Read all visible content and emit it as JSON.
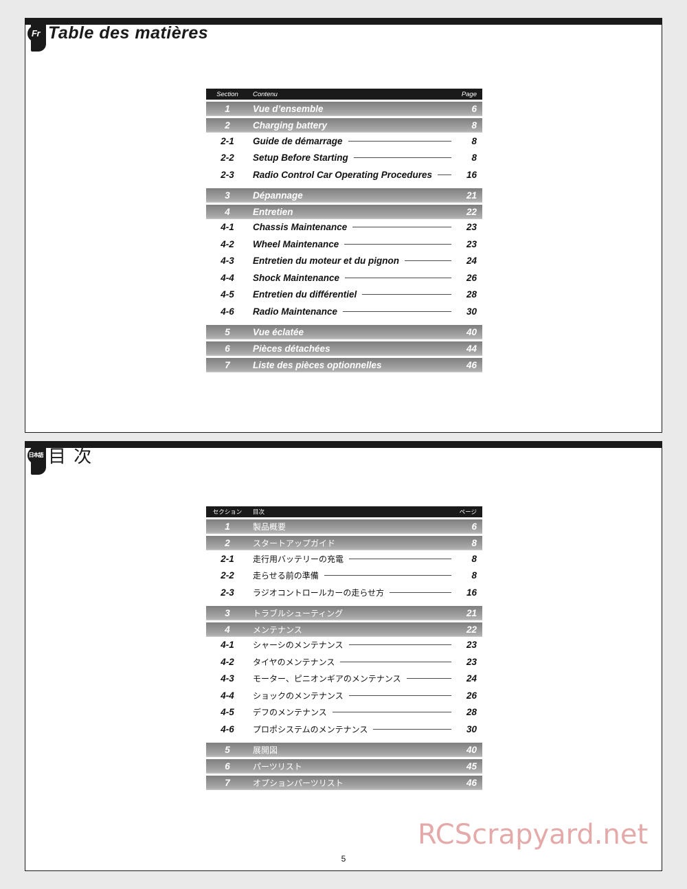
{
  "document": {
    "page_number": "5",
    "watermark": "RCScrapyard.net"
  },
  "sections": {
    "french": {
      "badge": "Fr",
      "title": "Table des matières",
      "table": {
        "headers": {
          "section": "Section",
          "content": "Contenu",
          "page": "Page"
        },
        "rows": [
          {
            "type": "major",
            "section": "1",
            "name": "Vue d’ensemble",
            "page": "6"
          },
          {
            "type": "major",
            "section": "2",
            "name": "Charging battery",
            "page": "8"
          },
          {
            "type": "sub",
            "section": "2-1",
            "name": "Guide de démarrage",
            "page": "8"
          },
          {
            "type": "sub",
            "section": "2-2",
            "name": "Setup Before Starting",
            "page": "8"
          },
          {
            "type": "sub",
            "section": "2-3",
            "name": "Radio Control Car Operating Procedures",
            "page": "16"
          },
          {
            "type": "major",
            "section": "3",
            "name": "Dépannage",
            "page": "21"
          },
          {
            "type": "major",
            "section": "4",
            "name": "Entretien",
            "page": "22"
          },
          {
            "type": "sub",
            "section": "4-1",
            "name": "Chassis Maintenance",
            "page": "23"
          },
          {
            "type": "sub",
            "section": "4-2",
            "name": "Wheel Maintenance",
            "page": "23"
          },
          {
            "type": "sub",
            "section": "4-3",
            "name": "Entretien du moteur et du pignon",
            "page": "24"
          },
          {
            "type": "sub",
            "section": "4-4",
            "name": "Shock Maintenance",
            "page": "26"
          },
          {
            "type": "sub",
            "section": "4-5",
            "name": "Entretien du différentiel",
            "page": "28"
          },
          {
            "type": "sub",
            "section": "4-6",
            "name": "Radio Maintenance",
            "page": "30"
          },
          {
            "type": "major",
            "section": "5",
            "name": "Vue éclatée",
            "page": "40"
          },
          {
            "type": "major",
            "section": "6",
            "name": "Pièces détachées",
            "page": "44"
          },
          {
            "type": "major",
            "section": "7",
            "name": "Liste des pièces optionnelles",
            "page": "46"
          }
        ]
      }
    },
    "japanese": {
      "badge": "日本語",
      "title": "目 次",
      "table": {
        "headers": {
          "section": "セクション",
          "content": "目次",
          "page": "ページ"
        },
        "rows": [
          {
            "type": "major",
            "section": "1",
            "name": "製品概要",
            "page": "6"
          },
          {
            "type": "major",
            "section": "2",
            "name": "スタートアップガイド",
            "page": "8"
          },
          {
            "type": "sub",
            "section": "2-1",
            "name": "走行用バッテリーの充電",
            "page": "8"
          },
          {
            "type": "sub",
            "section": "2-2",
            "name": "走らせる前の準備",
            "page": "8"
          },
          {
            "type": "sub",
            "section": "2-3",
            "name": "ラジオコントロールカーの走らせ方",
            "page": "16"
          },
          {
            "type": "major",
            "section": "3",
            "name": "トラブルシューティング",
            "page": "21"
          },
          {
            "type": "major",
            "section": "4",
            "name": "メンテナンス",
            "page": "22"
          },
          {
            "type": "sub",
            "section": "4-1",
            "name": "シャーシのメンテナンス",
            "page": "23"
          },
          {
            "type": "sub",
            "section": "4-2",
            "name": "タイヤのメンテナンス",
            "page": "23"
          },
          {
            "type": "sub",
            "section": "4-3",
            "name": "モーター、ピニオンギアのメンテナンス",
            "page": "24"
          },
          {
            "type": "sub",
            "section": "4-4",
            "name": "ショックのメンテナンス",
            "page": "26"
          },
          {
            "type": "sub",
            "section": "4-5",
            "name": "デフのメンテナンス",
            "page": "28"
          },
          {
            "type": "sub",
            "section": "4-6",
            "name": "プロポシステムのメンテナンス",
            "page": "30"
          },
          {
            "type": "major",
            "section": "5",
            "name": "展開図",
            "page": "40"
          },
          {
            "type": "major",
            "section": "6",
            "name": "パーツリスト",
            "page": "45"
          },
          {
            "type": "major",
            "section": "7",
            "name": "オプションパーツリスト",
            "page": "46"
          }
        ]
      }
    }
  }
}
